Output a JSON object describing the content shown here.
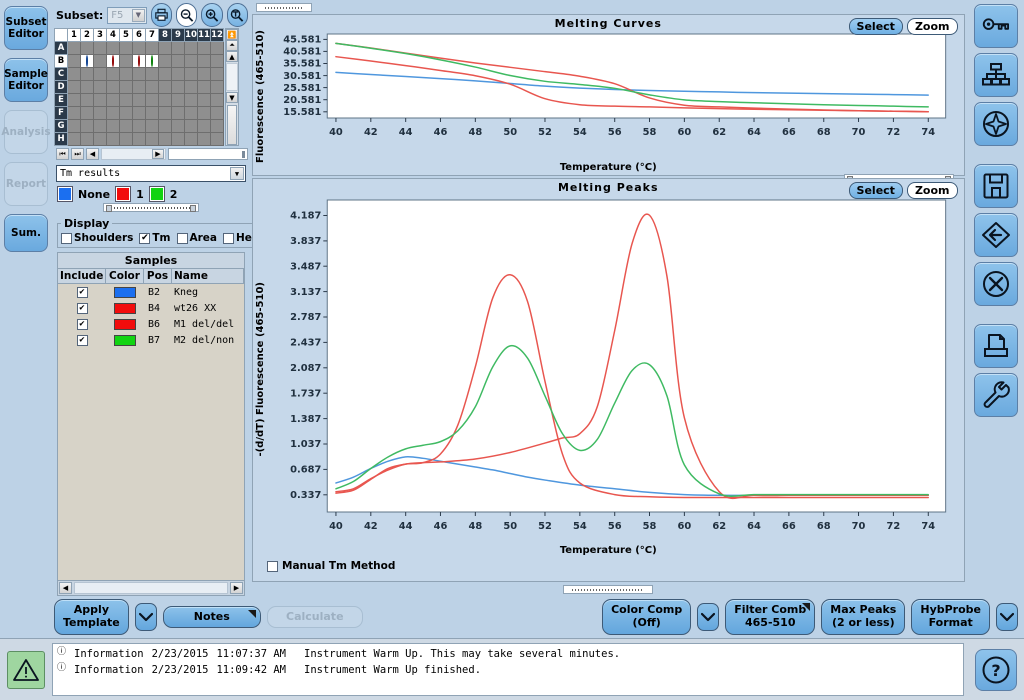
{
  "sidebar": {
    "items": [
      {
        "label": "Subset\nEditor",
        "name": "subset-editor",
        "enabled": true
      },
      {
        "label": "Sample\nEditor",
        "name": "sample-editor",
        "enabled": true
      },
      {
        "label": "Analysis",
        "name": "analysis",
        "enabled": false
      },
      {
        "label": "Report",
        "name": "report",
        "enabled": false
      },
      {
        "label": "Sum.",
        "name": "summary",
        "enabled": true
      }
    ]
  },
  "subset": {
    "label": "Subset:",
    "value": "F5",
    "icons": [
      "print-icon",
      "zoom-out-icon",
      "zoom-in-icon",
      "zoom-reset-icon"
    ]
  },
  "plate": {
    "columns": [
      "1",
      "2",
      "3",
      "4",
      "5",
      "6",
      "7",
      "8",
      "9",
      "10",
      "11",
      "12"
    ],
    "rows": [
      "A",
      "B",
      "C",
      "D",
      "E",
      "F",
      "G",
      "H"
    ],
    "highlighted_columns": [
      "1",
      "2",
      "3",
      "4",
      "5",
      "6",
      "7"
    ],
    "highlighted_rows": [
      "B"
    ],
    "wells": [
      {
        "pos": "B2",
        "color": "#1b6ff0"
      },
      {
        "pos": "B4",
        "color": "#f20c0c"
      },
      {
        "pos": "B6",
        "color": "#f20c0c"
      },
      {
        "pos": "B7",
        "color": "#12d312"
      }
    ]
  },
  "results_combo": {
    "value": "Tm results"
  },
  "legend": {
    "entries": [
      {
        "color": "#1b6ff0",
        "label": "None"
      },
      {
        "color": "#f20c0c",
        "label": "1"
      },
      {
        "color": "#12d312",
        "label": "2"
      }
    ]
  },
  "display": {
    "title": "Display",
    "checkboxes": [
      {
        "label": "Shoulders",
        "checked": false
      },
      {
        "label": "Tm",
        "checked": true
      },
      {
        "label": "Area",
        "checked": false
      },
      {
        "label": "Hei",
        "checked": false
      }
    ]
  },
  "samples": {
    "title": "Samples",
    "headers": [
      "Include",
      "Color",
      "Pos",
      "Name"
    ],
    "rows": [
      {
        "include": true,
        "color": "#1b6ff0",
        "pos": "B2",
        "name": "Kneg"
      },
      {
        "include": true,
        "color": "#f20c0c",
        "pos": "B4",
        "name": "wt26 XX"
      },
      {
        "include": true,
        "color": "#f20c0c",
        "pos": "B6",
        "name": "M1 del/del"
      },
      {
        "include": true,
        "color": "#12d312",
        "pos": "B7",
        "name": "M2 del/non"
      }
    ]
  },
  "charts": {
    "select_label": "Select",
    "zoom_label": "Zoom",
    "manual_tm": {
      "label": "Manual Tm Method",
      "checked": false
    }
  },
  "chart_data": [
    {
      "type": "line",
      "title": "Melting Curves",
      "xlabel": "Temperature (°C)",
      "ylabel": "Fluorescence (465-510)",
      "xlim": [
        39.5,
        75.0
      ],
      "ylim": [
        13.0,
        47.8
      ],
      "xticks": [
        40,
        42,
        44,
        46,
        48,
        50,
        52,
        54,
        56,
        58,
        60,
        62,
        64,
        66,
        68,
        70,
        72,
        74
      ],
      "yticks": [
        15.581,
        20.581,
        25.581,
        30.581,
        35.581,
        40.581,
        45.581
      ],
      "grid": false,
      "legend_position": "none",
      "series": [
        {
          "name": "B2 Kneg",
          "color": "#4f97de",
          "x": [
            40,
            42,
            44,
            46,
            48,
            50,
            52,
            54,
            56,
            58,
            60,
            62,
            64,
            66,
            68,
            70,
            72,
            74
          ],
          "values": [
            31.9,
            31.0,
            30.2,
            29.3,
            28.4,
            27.3,
            26.2,
            25.4,
            24.8,
            24.4,
            24.1,
            23.8,
            23.5,
            23.3,
            23.1,
            22.9,
            22.7,
            22.5
          ]
        },
        {
          "name": "B4 wt26 XX",
          "color": "#e8564f",
          "x": [
            40,
            42,
            44,
            46,
            48,
            50,
            52,
            54,
            56,
            58,
            60,
            62,
            64,
            66,
            68,
            70,
            72,
            74
          ],
          "values": [
            38.4,
            36.6,
            34.7,
            32.7,
            30.5,
            27.0,
            21.0,
            18.5,
            17.9,
            17.6,
            17.2,
            16.9,
            16.6,
            16.4,
            16.2,
            16.0,
            15.8,
            15.6
          ]
        },
        {
          "name": "B6 M1 del/del",
          "color": "#e8564f",
          "x": [
            40,
            42,
            44,
            46,
            48,
            50,
            52,
            54,
            56,
            58,
            60,
            62,
            64,
            66,
            68,
            70,
            72,
            74
          ],
          "values": [
            43.9,
            42.0,
            39.9,
            37.8,
            35.8,
            34.0,
            32.2,
            30.3,
            27.2,
            21.3,
            18.3,
            17.6,
            17.1,
            16.7,
            16.3,
            16.0,
            15.8,
            15.6
          ]
        },
        {
          "name": "B7 M2 del/non",
          "color": "#3fba62",
          "x": [
            40,
            42,
            44,
            46,
            48,
            50,
            52,
            54,
            56,
            58,
            60,
            62,
            64,
            66,
            68,
            70,
            72,
            74
          ],
          "values": [
            43.9,
            41.9,
            39.7,
            37.1,
            34.1,
            30.6,
            28.2,
            26.9,
            25.3,
            22.6,
            20.5,
            19.8,
            19.3,
            18.9,
            18.5,
            18.2,
            17.9,
            17.6
          ]
        }
      ]
    },
    {
      "type": "line",
      "title": "Melting Peaks",
      "xlabel": "Temperature (°C)",
      "ylabel": "-(d/dT) Fluorescence (465-510)",
      "xlim": [
        39.5,
        75.0
      ],
      "ylim": [
        0.1,
        4.4
      ],
      "xticks": [
        40,
        42,
        44,
        46,
        48,
        50,
        52,
        54,
        56,
        58,
        60,
        62,
        64,
        66,
        68,
        70,
        72,
        74
      ],
      "yticks": [
        0.337,
        0.687,
        1.037,
        1.387,
        1.737,
        2.087,
        2.437,
        2.787,
        3.137,
        3.487,
        3.837,
        4.187
      ],
      "grid": false,
      "legend_position": "none",
      "series": [
        {
          "name": "B2 Kneg",
          "color": "#4f97de",
          "x": [
            40,
            41,
            42,
            43,
            44,
            45,
            46,
            47,
            48,
            49,
            50,
            51,
            52,
            54,
            56,
            58,
            60,
            62,
            64,
            66,
            68,
            70,
            72,
            74
          ],
          "values": [
            0.5,
            0.58,
            0.7,
            0.8,
            0.86,
            0.84,
            0.8,
            0.76,
            0.72,
            0.68,
            0.63,
            0.58,
            0.54,
            0.47,
            0.42,
            0.37,
            0.34,
            0.33,
            0.33,
            0.33,
            0.33,
            0.33,
            0.33,
            0.33
          ]
        },
        {
          "name": "B4 wt26 XX",
          "color": "#e8564f",
          "x": [
            40,
            41,
            42,
            43,
            44,
            45,
            46,
            47,
            48,
            49,
            50,
            51,
            52,
            53,
            54,
            56,
            58,
            60,
            62,
            64,
            66,
            68,
            70,
            72,
            74
          ],
          "values": [
            0.36,
            0.4,
            0.55,
            0.7,
            0.76,
            0.78,
            0.9,
            1.3,
            2.1,
            3.05,
            3.37,
            3.0,
            1.9,
            0.9,
            0.5,
            0.34,
            0.31,
            0.3,
            0.3,
            0.3,
            0.3,
            0.3,
            0.3,
            0.3,
            0.3
          ]
        },
        {
          "name": "B6 M1 del/del",
          "color": "#e8564f",
          "x": [
            40,
            41,
            42,
            43,
            44,
            45,
            46,
            48,
            50,
            52,
            53,
            54,
            55,
            56,
            57,
            58,
            59,
            60,
            62,
            64,
            66,
            68,
            70,
            72,
            74
          ],
          "values": [
            0.38,
            0.42,
            0.56,
            0.68,
            0.76,
            0.78,
            0.79,
            0.83,
            0.92,
            1.05,
            1.12,
            1.18,
            1.55,
            2.6,
            3.8,
            4.19,
            3.35,
            1.4,
            0.38,
            0.33,
            0.33,
            0.33,
            0.33,
            0.33,
            0.33
          ]
        },
        {
          "name": "B7 M2 del/non",
          "color": "#3fba62",
          "x": [
            40,
            41,
            42,
            43,
            44,
            45,
            46,
            47,
            48,
            49,
            50,
            51,
            52,
            53,
            54,
            55,
            56,
            57,
            58,
            59,
            60,
            62,
            64,
            66,
            68,
            70,
            72,
            74
          ],
          "values": [
            0.42,
            0.52,
            0.7,
            0.86,
            0.97,
            1.02,
            1.07,
            1.22,
            1.55,
            2.1,
            2.39,
            2.22,
            1.7,
            1.18,
            0.95,
            1.1,
            1.6,
            2.05,
            2.13,
            1.7,
            0.75,
            0.35,
            0.34,
            0.34,
            0.34,
            0.34,
            0.34,
            0.34
          ]
        }
      ]
    }
  ],
  "bottom_buttons": {
    "left": [
      {
        "label": "Apply\nTemplate",
        "name": "apply-template",
        "enabled": true,
        "dropdown": true
      },
      {
        "label": "Notes",
        "name": "notes",
        "enabled": true,
        "corner": true
      },
      {
        "label": "Calculate",
        "name": "calculate",
        "enabled": false
      }
    ],
    "right": [
      {
        "label": "Color Comp\n(Off)",
        "name": "color-comp",
        "enabled": true,
        "dropdown": true
      },
      {
        "label": "Filter Comb\n465-510",
        "name": "filter-comb",
        "enabled": true,
        "corner": true
      },
      {
        "label": "Max Peaks\n(2 or less)",
        "name": "max-peaks",
        "enabled": true
      },
      {
        "label": "HybProbe\nFormat",
        "name": "hybprobe-format",
        "enabled": true,
        "dropdown": true
      }
    ]
  },
  "right_toolbar": {
    "icons": [
      "key-icon",
      "hierarchy-icon",
      "compass-icon",
      "save-icon",
      "back-arrow-icon",
      "close-circle-icon",
      "print-icon",
      "wrench-icon"
    ]
  },
  "statusbar": {
    "status_icon": "warning-icon",
    "help_label": "?",
    "log": [
      {
        "type": "Information",
        "date": "2/23/2015",
        "time": "11:07:37 AM",
        "message": "Instrument Warm Up. This may take several minutes."
      },
      {
        "type": "Information",
        "date": "2/23/2015",
        "time": "11:09:42 AM",
        "message": "Instrument Warm Up finished."
      }
    ]
  }
}
